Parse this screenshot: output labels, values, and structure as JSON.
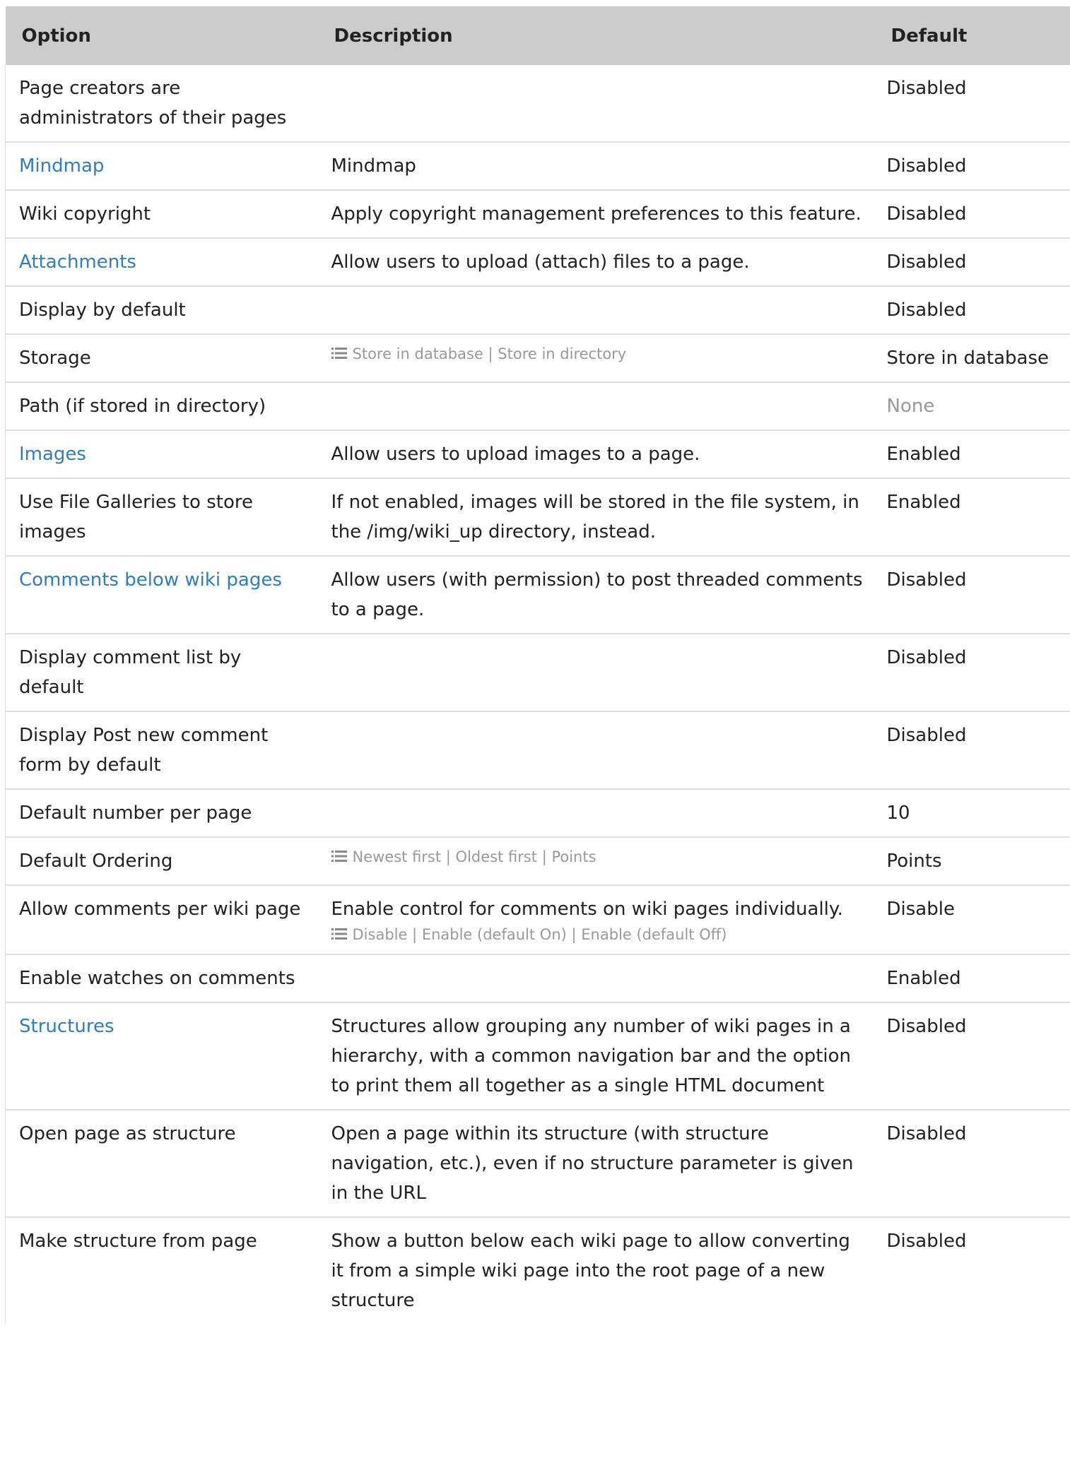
{
  "headers": {
    "option": "Option",
    "description": "Description",
    "default": "Default"
  },
  "rows": [
    {
      "option": "Page creators are administrators of their pages",
      "option_link": false,
      "description": "",
      "options_list": "",
      "default": "Disabled",
      "default_muted": false
    },
    {
      "option": "Mindmap",
      "option_link": true,
      "description": "Mindmap",
      "options_list": "",
      "default": "Disabled",
      "default_muted": false
    },
    {
      "option": "Wiki copyright",
      "option_link": false,
      "description": "Apply copyright management preferences to this feature.",
      "options_list": "",
      "default": "Disabled",
      "default_muted": false
    },
    {
      "option": "Attachments",
      "option_link": true,
      "description": "Allow users to upload (attach) files to a page.",
      "options_list": "",
      "default": "Disabled",
      "default_muted": false
    },
    {
      "option": "Display by default",
      "option_link": false,
      "description": "",
      "options_list": "",
      "default": "Disabled",
      "default_muted": false
    },
    {
      "option": "Storage",
      "option_link": false,
      "description": "",
      "options_list": "Store in database | Store in directory",
      "default": "Store in database",
      "default_muted": false
    },
    {
      "option": "Path (if stored in directory)",
      "option_link": false,
      "description": "",
      "options_list": "",
      "default": "None",
      "default_muted": true
    },
    {
      "option": "Images",
      "option_link": true,
      "description": "Allow users to upload images to a page.",
      "options_list": "",
      "default": "Enabled",
      "default_muted": false
    },
    {
      "option": "Use File Galleries to store images",
      "option_link": false,
      "description": "If not enabled, images will be stored in the file system, in the /img/wiki_up directory, instead.",
      "options_list": "",
      "default": "Enabled",
      "default_muted": false
    },
    {
      "option": "Comments below wiki pages",
      "option_link": true,
      "description": "Allow users (with permission) to post threaded comments to a page.",
      "options_list": "",
      "default": "Disabled",
      "default_muted": false
    },
    {
      "option": "Display comment list by default",
      "option_link": false,
      "description": "",
      "options_list": "",
      "default": "Disabled",
      "default_muted": false
    },
    {
      "option": "Display Post new comment form by default",
      "option_link": false,
      "description": "",
      "options_list": "",
      "default": "Disabled",
      "default_muted": false
    },
    {
      "option": "Default number per page",
      "option_link": false,
      "description": "",
      "options_list": "",
      "default": "10",
      "default_muted": false
    },
    {
      "option": "Default Ordering",
      "option_link": false,
      "description": "",
      "options_list": "Newest first | Oldest first | Points",
      "default": "Points",
      "default_muted": false
    },
    {
      "option": "Allow comments per wiki page",
      "option_link": false,
      "description": "Enable control for comments on wiki pages individually.",
      "options_list": "Disable | Enable (default On) | Enable (default Off)",
      "default": "Disable",
      "default_muted": false
    },
    {
      "option": "Enable watches on comments",
      "option_link": false,
      "description": "",
      "options_list": "",
      "default": "Enabled",
      "default_muted": false
    },
    {
      "option": "Structures",
      "option_link": true,
      "description": "Structures allow grouping any number of wiki pages in a hierarchy, with a common navigation bar and the option to print them all together as a single HTML document",
      "options_list": "",
      "default": "Disabled",
      "default_muted": false
    },
    {
      "option": "Open page as structure",
      "option_link": false,
      "description": "Open a page within its structure (with structure navigation, etc.), even if no structure parameter is given in the URL",
      "options_list": "",
      "default": "Disabled",
      "default_muted": false
    },
    {
      "option": "Make structure from page",
      "option_link": false,
      "description": "Show a button below each wiki page to allow converting it from a simple wiki page into the root page of a new structure",
      "options_list": "",
      "default": "Disabled",
      "default_muted": false
    }
  ],
  "colors": {
    "header_bg": "#cccccc",
    "link": "#2f7dbe",
    "muted": "#999999",
    "row_border": "#dddddd"
  }
}
